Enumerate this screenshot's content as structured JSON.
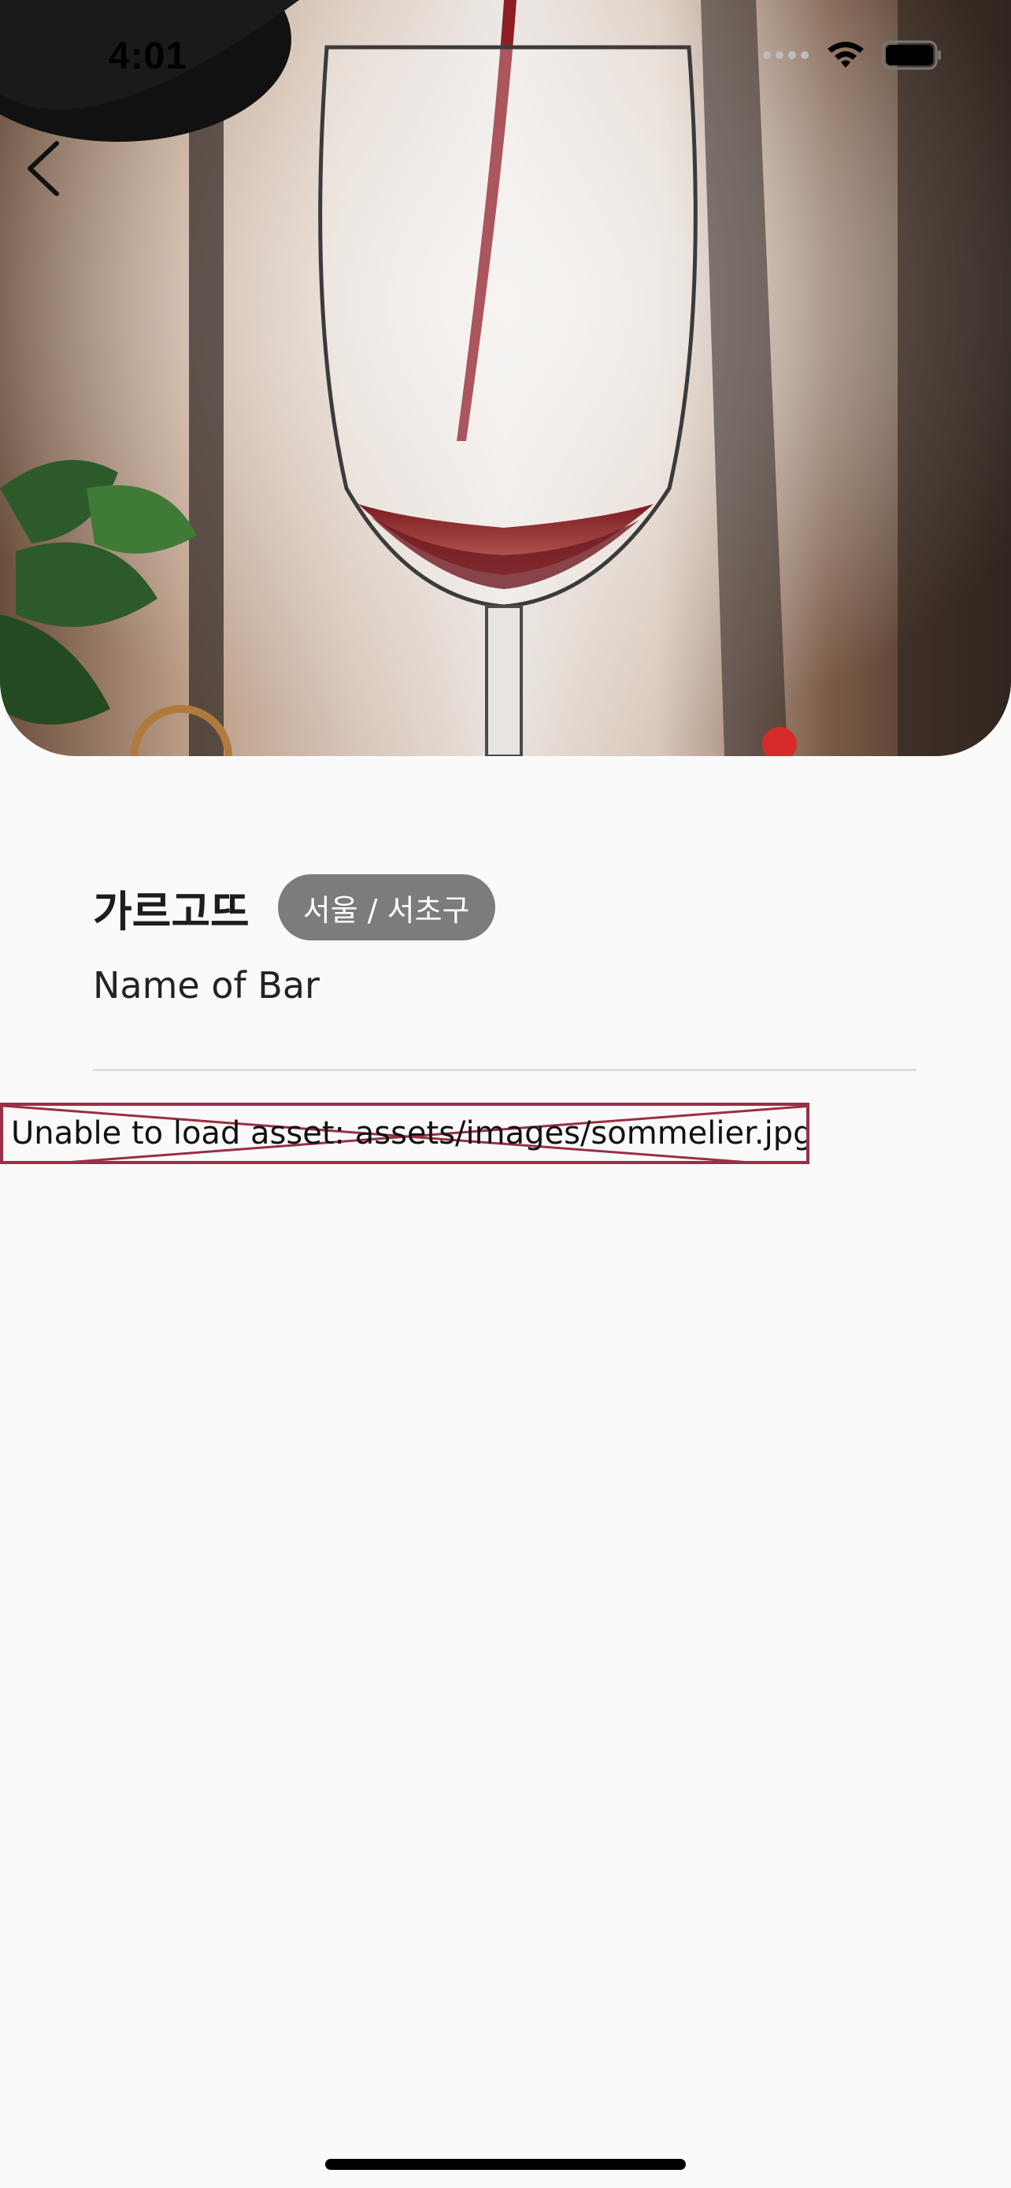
{
  "status_bar": {
    "time": "4:01",
    "icons": [
      "cellular-signal-icon",
      "wifi-icon",
      "battery-icon"
    ]
  },
  "hero": {
    "image_subject": "wine-glass-pour-photo",
    "back_icon": "chevron-left-icon"
  },
  "bar": {
    "name_korean": "가르고뜨",
    "region": "서울 / 서초구",
    "name_english": "Name of Bar"
  },
  "error": {
    "message": "Unable to load asset: assets/images/sommelier.jpg"
  },
  "colors": {
    "background": "#fafafa",
    "badge": "#7c7c7c",
    "error_border": "#9a2f45",
    "divider": "#dcdcdc"
  }
}
